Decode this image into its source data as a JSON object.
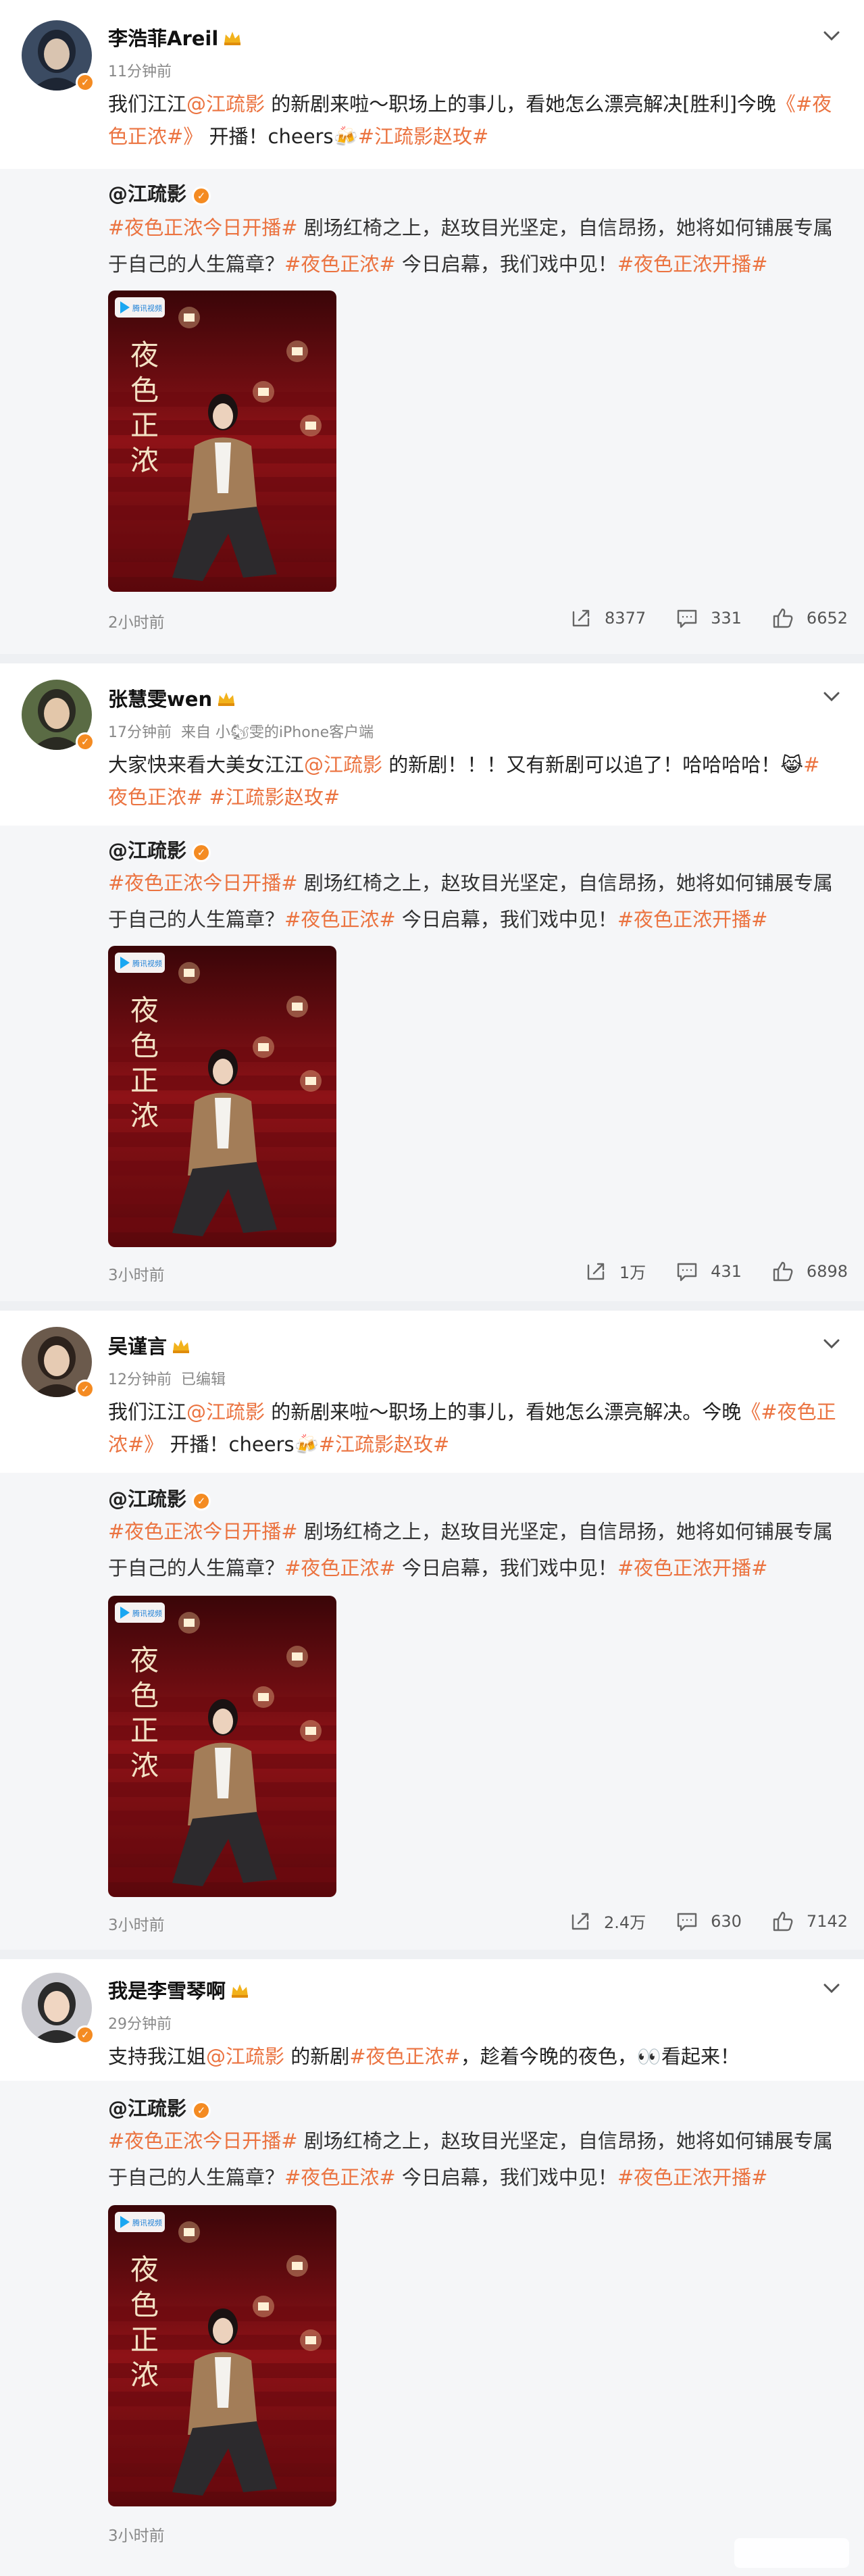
{
  "posts": [
    {
      "username": "李浩菲Areil",
      "time": "11分钟前",
      "source": "",
      "text": [
        {
          "t": "我们江江"
        },
        {
          "t": "@江疏影",
          "k": "at"
        },
        {
          "t": " 的新剧来啦～职场上的事儿，看她怎么漂亮解决[胜利]今晚"
        },
        {
          "t": "《#夜色正浓#》",
          "k": "tag"
        },
        {
          "t": " 开播！cheers🍻"
        },
        {
          "t": "#江疏影赵玫#",
          "k": "tag"
        }
      ],
      "retweet": {
        "author": "@江疏影",
        "body": [
          {
            "t": "#夜色正浓今日开播#",
            "k": "tag"
          },
          {
            "t": " 剧场红椅之上，赵玫目光坚定，自信昂扬，她将如何铺展专属于自己的人生篇章？"
          },
          {
            "t": "#夜色正浓#",
            "k": "tag"
          },
          {
            "t": " 今日启幕，我们戏中见！"
          },
          {
            "t": "#夜色正浓开播#",
            "k": "tag"
          }
        ],
        "poster_title": "夜色正浓",
        "poster_logo": "腾讯视频",
        "time": "2小时前",
        "reposts": "8377",
        "comments": "331",
        "likes": "6652"
      }
    },
    {
      "username": "张慧雯wen",
      "time": "17分钟前",
      "source": "来自 小🐿雯的iPhone客户端",
      "text": [
        {
          "t": "大家快来看大美女江江"
        },
        {
          "t": "@江疏影",
          "k": "at"
        },
        {
          "t": " 的新剧！！！又有新剧可以追了！哈哈哈哈！😹"
        },
        {
          "t": "#夜色正浓#",
          "k": "tag"
        },
        {
          "t": " "
        },
        {
          "t": "#江疏影赵玫#",
          "k": "tag"
        }
      ],
      "retweet": {
        "author": "@江疏影",
        "body": [
          {
            "t": "#夜色正浓今日开播#",
            "k": "tag"
          },
          {
            "t": " 剧场红椅之上，赵玫目光坚定，自信昂扬，她将如何铺展专属于自己的人生篇章？"
          },
          {
            "t": "#夜色正浓#",
            "k": "tag"
          },
          {
            "t": " 今日启幕，我们戏中见！"
          },
          {
            "t": "#夜色正浓开播#",
            "k": "tag"
          }
        ],
        "poster_title": "夜色正浓",
        "poster_logo": "腾讯视频",
        "time": "3小时前",
        "reposts": "1万",
        "comments": "431",
        "likes": "6898"
      }
    },
    {
      "username": "吴谨言",
      "time": "12分钟前",
      "source": "已编辑",
      "text": [
        {
          "t": "我们江江"
        },
        {
          "t": "@江疏影",
          "k": "at"
        },
        {
          "t": " 的新剧来啦～职场上的事儿，看她怎么漂亮解决。今晚"
        },
        {
          "t": "《#夜色正浓#》",
          "k": "tag"
        },
        {
          "t": " 开播！cheers🍻"
        },
        {
          "t": "#江疏影赵玫#",
          "k": "tag"
        }
      ],
      "retweet": {
        "author": "@江疏影",
        "body": [
          {
            "t": "#夜色正浓今日开播#",
            "k": "tag"
          },
          {
            "t": " 剧场红椅之上，赵玫目光坚定，自信昂扬，她将如何铺展专属于自己的人生篇章？"
          },
          {
            "t": "#夜色正浓#",
            "k": "tag"
          },
          {
            "t": " 今日启幕，我们戏中见！"
          },
          {
            "t": "#夜色正浓开播#",
            "k": "tag"
          }
        ],
        "poster_title": "夜色正浓",
        "poster_logo": "腾讯视频",
        "time": "3小时前",
        "reposts": "2.4万",
        "comments": "630",
        "likes": "7142"
      }
    },
    {
      "username": "我是李雪琴啊",
      "time": "29分钟前",
      "source": "",
      "text": [
        {
          "t": "支持我江姐"
        },
        {
          "t": "@江疏影",
          "k": "at"
        },
        {
          "t": " 的新剧"
        },
        {
          "t": "#夜色正浓#",
          "k": "tag"
        },
        {
          "t": "，趁着今晚的夜色，👀看起来！"
        }
      ],
      "retweet": {
        "author": "@江疏影",
        "body": [
          {
            "t": "#夜色正浓今日开播#",
            "k": "tag"
          },
          {
            "t": " 剧场红椅之上，赵玫目光坚定，自信昂扬，她将如何铺展专属于自己的人生篇章？"
          },
          {
            "t": "#夜色正浓#",
            "k": "tag"
          },
          {
            "t": " 今日启幕，我们戏中见！"
          },
          {
            "t": "#夜色正浓开播#",
            "k": "tag"
          }
        ],
        "poster_title": "夜色正浓",
        "poster_logo": "腾讯视频",
        "time": "3小时前",
        "reposts": "",
        "comments": "",
        "likes": ""
      }
    }
  ],
  "colors": {
    "link": "#eb7340",
    "badge": "#f48b22",
    "poster_bg": "#8e1217"
  }
}
